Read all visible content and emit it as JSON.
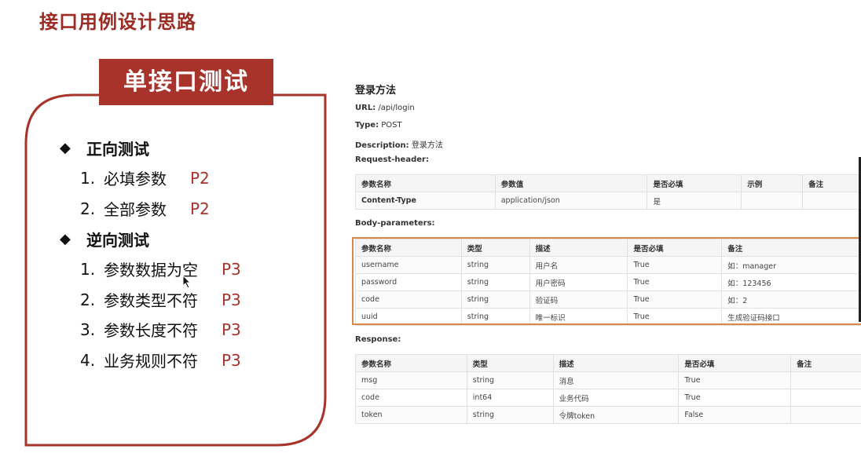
{
  "page": {
    "title": "接口用例设计思路"
  },
  "card": {
    "title": "单接口测试",
    "sections": [
      {
        "bullet": "◆",
        "label": "正向测试",
        "items": [
          {
            "num": "1.",
            "text": "必填参数",
            "priority": "P2"
          },
          {
            "num": "2.",
            "text": "全部参数",
            "priority": "P2"
          }
        ]
      },
      {
        "bullet": "◆",
        "label": "逆向测试",
        "items": [
          {
            "num": "1.",
            "text": "参数数据为空",
            "priority": "P3"
          },
          {
            "num": "2.",
            "text": "参数类型不符",
            "priority": "P3"
          },
          {
            "num": "3.",
            "text": "参数长度不符",
            "priority": "P3"
          },
          {
            "num": "4.",
            "text": "业务规则不符",
            "priority": "P3"
          }
        ]
      }
    ]
  },
  "doc": {
    "heading": "登录方法",
    "url_label": "URL:",
    "url_value": "/api/login",
    "type_label": "Type:",
    "type_value": "POST",
    "desc_label": "Description:",
    "desc_value": "登录方法",
    "request_header_label": "Request-header:",
    "body_params_label": "Body-parameters:",
    "response_label": "Response:",
    "header_table": {
      "columns": [
        "参数名称",
        "参数值",
        "是否必填",
        "示例",
        "备注"
      ],
      "rows": [
        [
          "Content-Type",
          "application/json",
          "是",
          "",
          ""
        ]
      ]
    },
    "body_table": {
      "columns": [
        "参数名称",
        "类型",
        "描述",
        "是否必填",
        "备注"
      ],
      "rows": [
        [
          "username",
          "string",
          "用户名",
          "True",
          "如：manager"
        ],
        [
          "password",
          "string",
          "用户密码",
          "True",
          "如：123456"
        ],
        [
          "code",
          "string",
          "验证码",
          "True",
          "如：2"
        ],
        [
          "uuid",
          "string",
          "唯一标识",
          "True",
          "生成验证码接口"
        ]
      ]
    },
    "response_table": {
      "columns": [
        "参数名称",
        "类型",
        "描述",
        "是否必填",
        "备注"
      ],
      "rows": [
        [
          "msg",
          "string",
          "消息",
          "True",
          ""
        ],
        [
          "code",
          "int64",
          "业务代码",
          "True",
          ""
        ],
        [
          "token",
          "string",
          "令牌token",
          "False",
          ""
        ]
      ]
    }
  },
  "colors": {
    "accent": "#a7332b",
    "title": "#9b2b23",
    "highlight_box": "#d9884a"
  }
}
